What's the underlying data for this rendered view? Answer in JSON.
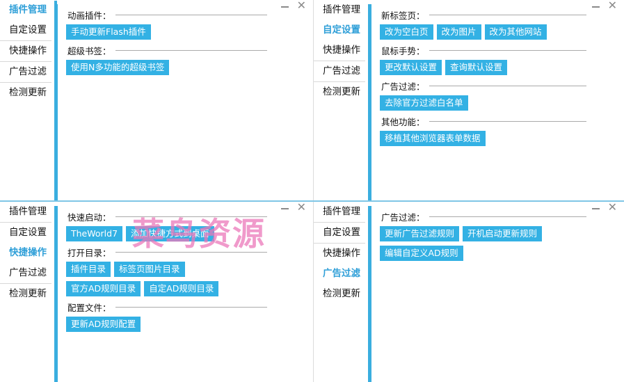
{
  "nav": [
    "插件管理",
    "自定设置",
    "快捷操作",
    "广告过滤",
    "检测更新"
  ],
  "panels": [
    {
      "active": 0,
      "sections": [
        {
          "title": "动画插件：",
          "buttons": [
            "手动更新Flash插件"
          ]
        },
        {
          "title": "超级书签：",
          "buttons": [
            "使用N多功能的超级书签"
          ]
        }
      ]
    },
    {
      "active": 1,
      "sections": [
        {
          "title": "新标签页：",
          "buttons": [
            "改为空白页",
            "改为图片",
            "改为其他网站"
          ]
        },
        {
          "title": "鼠标手势：",
          "buttons": [
            "更改默认设置",
            "查询默认设置"
          ]
        },
        {
          "title": "广告过滤：",
          "buttons": [
            "去除官方过滤白名单"
          ]
        },
        {
          "title": "其他功能：",
          "buttons": [
            "移植其他浏览器表单数据"
          ]
        }
      ]
    },
    {
      "active": 2,
      "sections": [
        {
          "title": "快速启动：",
          "buttons": [
            "TheWorld7",
            "添加快捷方式到桌面"
          ]
        },
        {
          "title": "打开目录：",
          "buttons": [
            "插件目录",
            "标签页图片目录"
          ]
        },
        {
          "title": "",
          "buttons": [
            "官方AD规则目录",
            "自定AD规则目录"
          ]
        },
        {
          "title": "配置文件：",
          "buttons": [
            "更新AD规则配置"
          ]
        }
      ]
    },
    {
      "active": 3,
      "sections": [
        {
          "title": "广告过滤：",
          "buttons": [
            "更新广告过滤规则",
            "开机启动更新规则"
          ]
        },
        {
          "title": "",
          "buttons": [
            "编辑自定义AD规则"
          ]
        }
      ]
    }
  ],
  "window_buttons": {
    "minimize": "—",
    "close": "✕"
  },
  "watermark": "菜鸟资源",
  "colors": {
    "accent": "#3aaedf",
    "button": "#33b1e4",
    "active_text": "#2f9fd8"
  }
}
